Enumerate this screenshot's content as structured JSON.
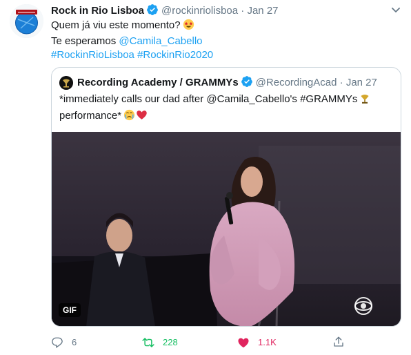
{
  "tweet": {
    "author_name": "Rock in Rio Lisboa",
    "author_handle": "@rockinriolisboa",
    "separator": "·",
    "date": "Jan 27",
    "lines": [
      "Quem já viu este momento?",
      "Te esperamos ",
      "#RockinRioLisboa #RockinRio2020"
    ],
    "mention": "@Camila_Cabello",
    "emoji": "star-struck-emoji"
  },
  "quoted": {
    "author_name": "Recording Academy / GRAMMYs",
    "author_handle": "@RecordingAcad",
    "separator": "·",
    "date": "Jan 27",
    "line1": "*immediately calls our dad after @Camila_Cabello's #GRAMMYs",
    "line2": "performance*",
    "media_badge": "GIF",
    "icons": [
      "gramophone-emoji",
      "crying-face-emoji",
      "red-heart-emoji"
    ]
  },
  "actions": {
    "reply_count": "6",
    "retweet_count": "228",
    "like_count": "1.1K"
  },
  "colors": {
    "link": "#1da1f2",
    "muted": "#657786",
    "retweet": "#17bf63",
    "like": "#e0245e",
    "border": "#ccd6dd"
  }
}
